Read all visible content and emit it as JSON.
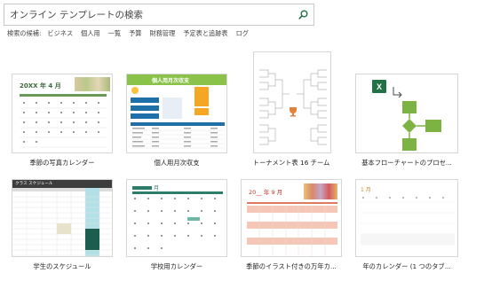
{
  "search": {
    "value": "オンライン テンプレートの検索",
    "placeholder": "オンライン テンプレートの検索",
    "icon": "search-icon"
  },
  "suggestions": {
    "label": "検索の候補:",
    "items": [
      "ビジネス",
      "個人用",
      "一覧",
      "予算",
      "財務管理",
      "予定表と追跡表",
      "ログ"
    ]
  },
  "templates": [
    {
      "title": "季節の写真カレンダー",
      "preview": {
        "heading": "20XX 年 4 月"
      }
    },
    {
      "title": "個人用月次収支",
      "preview": {
        "heading": "個人用月次収支"
      }
    },
    {
      "title": "トーナメント表 16 チーム",
      "preview": {}
    },
    {
      "title": "基本フローチャートのプロセ...",
      "preview": {
        "app_badge": "X"
      }
    },
    {
      "title": "学生のスケジュール",
      "preview": {
        "heading": "クラス スケジュール"
      }
    },
    {
      "title": "学校用カレンダー",
      "preview": {
        "heading": "月"
      }
    },
    {
      "title": "季節のイラスト付きの万年カ...",
      "preview": {
        "heading": "20__ 年 9 月"
      }
    },
    {
      "title": "年のカレンダー (1 つのタブ...",
      "preview": {
        "heading": "1 月"
      }
    }
  ],
  "colors": {
    "accent_green": "#217346",
    "calendar_green": "#4a7c59",
    "budget_header": "#7cb342",
    "teal": "#2e7d6b",
    "salmon": "#f4c7b8"
  }
}
